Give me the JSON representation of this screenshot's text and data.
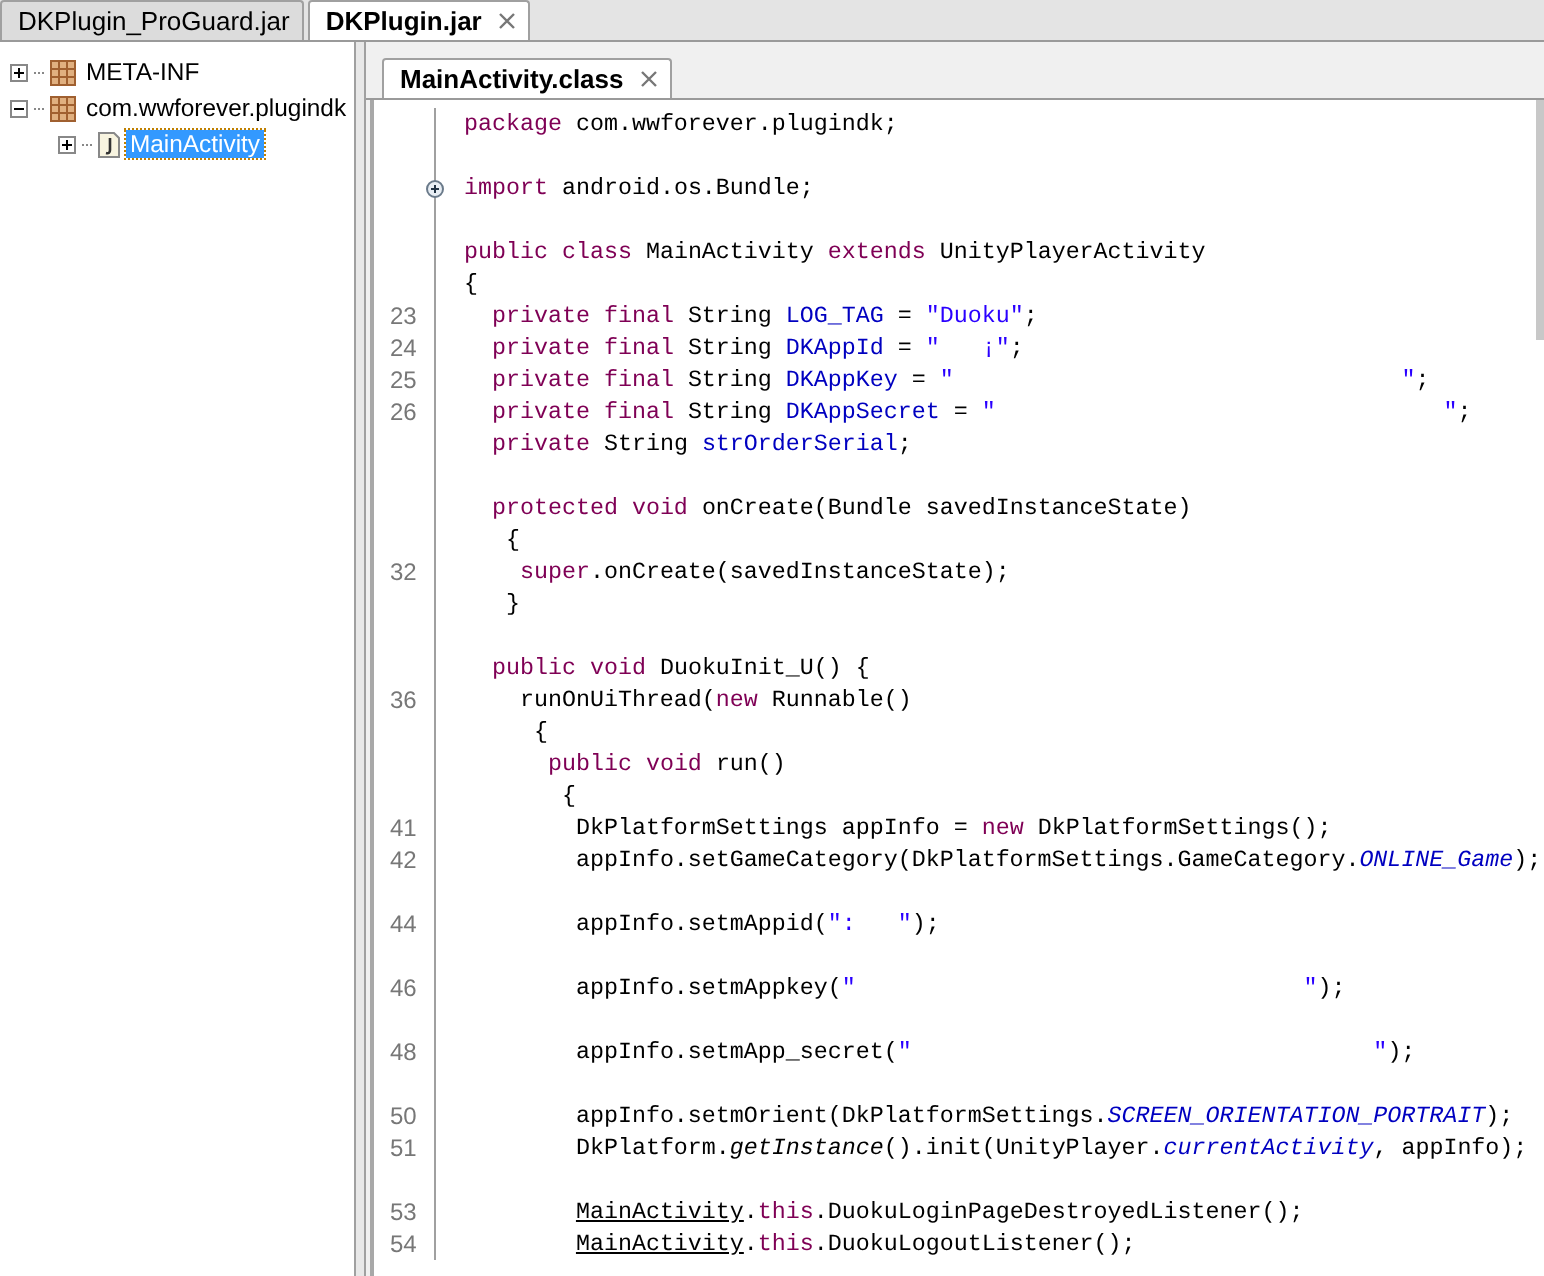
{
  "file_tabs": [
    {
      "label": "DKPlugin_ProGuard.jar",
      "selected": false
    },
    {
      "label": "DKPlugin.jar",
      "selected": true
    }
  ],
  "tree": [
    {
      "label": "META-INF",
      "kind": "package",
      "expanded": false,
      "selected": false
    },
    {
      "label": "com.wwforever.plugindk",
      "kind": "package",
      "expanded": true,
      "selected": false,
      "children": [
        {
          "label": "MainActivity",
          "kind": "class",
          "expanded": false,
          "selected": true
        }
      ]
    }
  ],
  "editor_tabs": [
    {
      "label": "MainActivity.class",
      "selected": true
    }
  ],
  "code_lines": [
    {
      "tokens": [
        {
          "kind": "keyword",
          "text": "package"
        },
        {
          "kind": "plain",
          "text": " com.wwforever.plugindk;"
        }
      ]
    },
    {
      "gap_before": true,
      "folded": true,
      "tokens": [
        {
          "kind": "keyword",
          "text": "import"
        },
        {
          "kind": "plain",
          "text": " android.os.Bundle;"
        }
      ]
    },
    {
      "gap_before": true,
      "tokens": [
        {
          "kind": "keyword",
          "text": "public class"
        },
        {
          "kind": "plain",
          "text": " MainActivity "
        },
        {
          "kind": "keyword",
          "text": "extends"
        },
        {
          "kind": "plain",
          "text": " UnityPlayerActivity"
        }
      ]
    },
    {
      "tokens": [
        {
          "kind": "plain",
          "text": "{"
        }
      ]
    },
    {
      "number": "23",
      "tokens": [
        {
          "kind": "keyword",
          "text": "  private final"
        },
        {
          "kind": "plain",
          "text": " String "
        },
        {
          "kind": "field",
          "text": "LOG_TAG"
        },
        {
          "kind": "plain",
          "text": " = "
        },
        {
          "kind": "string",
          "text": "\"Duoku\""
        },
        {
          "kind": "plain",
          "text": ";"
        }
      ]
    },
    {
      "number": "24",
      "tokens": [
        {
          "kind": "keyword",
          "text": "  private final"
        },
        {
          "kind": "plain",
          "text": " String "
        },
        {
          "kind": "field",
          "text": "DKAppId"
        },
        {
          "kind": "plain",
          "text": " = "
        },
        {
          "kind": "string",
          "text": "\"   ¡\""
        },
        {
          "kind": "plain",
          "text": ";"
        }
      ]
    },
    {
      "number": "25",
      "tokens": [
        {
          "kind": "keyword",
          "text": "  private final"
        },
        {
          "kind": "plain",
          "text": " String "
        },
        {
          "kind": "field",
          "text": "DKAppKey"
        },
        {
          "kind": "plain",
          "text": " = "
        },
        {
          "kind": "string",
          "text": "\"                                \""
        },
        {
          "kind": "plain",
          "text": ";"
        }
      ]
    },
    {
      "number": "26",
      "tokens": [
        {
          "kind": "keyword",
          "text": "  private final"
        },
        {
          "kind": "plain",
          "text": " String "
        },
        {
          "kind": "field",
          "text": "DKAppSecret"
        },
        {
          "kind": "plain",
          "text": " = "
        },
        {
          "kind": "string",
          "text": "\"                                \""
        },
        {
          "kind": "plain",
          "text": ";"
        }
      ]
    },
    {
      "tokens": [
        {
          "kind": "keyword",
          "text": "  private"
        },
        {
          "kind": "plain",
          "text": " String "
        },
        {
          "kind": "field",
          "text": "strOrderSerial"
        },
        {
          "kind": "plain",
          "text": ";"
        }
      ]
    },
    {
      "gap_before": true,
      "tokens": [
        {
          "kind": "keyword",
          "text": "  protected void"
        },
        {
          "kind": "plain",
          "text": " onCreate(Bundle savedInstanceState)"
        }
      ]
    },
    {
      "tokens": [
        {
          "kind": "plain",
          "text": "   {"
        }
      ]
    },
    {
      "number": "32",
      "tokens": [
        {
          "kind": "keyword",
          "text": "    super"
        },
        {
          "kind": "plain",
          "text": ".onCreate(savedInstanceState);"
        }
      ]
    },
    {
      "tokens": [
        {
          "kind": "plain",
          "text": "   }"
        }
      ]
    },
    {
      "gap_before": true,
      "tokens": [
        {
          "kind": "keyword",
          "text": "  public void"
        },
        {
          "kind": "plain",
          "text": " DuokuInit_U() {"
        }
      ]
    },
    {
      "number": "36",
      "tokens": [
        {
          "kind": "plain",
          "text": "    runOnUiThread("
        },
        {
          "kind": "keyword",
          "text": "new"
        },
        {
          "kind": "plain",
          "text": " Runnable()"
        }
      ]
    },
    {
      "tokens": [
        {
          "kind": "plain",
          "text": "     {"
        }
      ]
    },
    {
      "tokens": [
        {
          "kind": "keyword",
          "text": "      public void"
        },
        {
          "kind": "plain",
          "text": " run()"
        }
      ]
    },
    {
      "tokens": [
        {
          "kind": "plain",
          "text": "       {"
        }
      ]
    },
    {
      "number": "41",
      "tokens": [
        {
          "kind": "plain",
          "text": "        DkPlatformSettings appInfo = "
        },
        {
          "kind": "keyword",
          "text": "new"
        },
        {
          "kind": "plain",
          "text": " DkPlatformSettings();"
        }
      ]
    },
    {
      "number": "42",
      "tokens": [
        {
          "kind": "plain",
          "text": "        appInfo.setGameCategory(DkPlatformSettings.GameCategory."
        },
        {
          "kind": "static-field",
          "text": "ONLINE_Game"
        },
        {
          "kind": "plain",
          "text": ");"
        }
      ]
    },
    {
      "gap_before": true,
      "number": "44",
      "tokens": [
        {
          "kind": "plain",
          "text": "        appInfo.setmAppid("
        },
        {
          "kind": "string",
          "text": "\":   \""
        },
        {
          "kind": "plain",
          "text": ");"
        }
      ]
    },
    {
      "gap_before": true,
      "number": "46",
      "tokens": [
        {
          "kind": "plain",
          "text": "        appInfo.setmAppkey("
        },
        {
          "kind": "string",
          "text": "\"                                \""
        },
        {
          "kind": "plain",
          "text": ");"
        }
      ]
    },
    {
      "gap_before": true,
      "number": "48",
      "tokens": [
        {
          "kind": "plain",
          "text": "        appInfo.setmApp_secret("
        },
        {
          "kind": "string",
          "text": "\"                                 \""
        },
        {
          "kind": "plain",
          "text": ");"
        }
      ]
    },
    {
      "gap_before": true,
      "number": "50",
      "tokens": [
        {
          "kind": "plain",
          "text": "        appInfo.setmOrient(DkPlatformSettings."
        },
        {
          "kind": "static-field",
          "text": "SCREEN_ORIENTATION_PORTRAIT"
        },
        {
          "kind": "plain",
          "text": ");"
        }
      ]
    },
    {
      "number": "51",
      "tokens": [
        {
          "kind": "plain",
          "text": "        DkPlatform."
        },
        {
          "kind": "static-method",
          "text": "getInstance"
        },
        {
          "kind": "plain",
          "text": "().init(UnityPlayer."
        },
        {
          "kind": "static-field",
          "text": "currentActivity"
        },
        {
          "kind": "plain",
          "text": ", appInfo);"
        }
      ]
    },
    {
      "gap_before": true,
      "number": "53",
      "tokens": [
        {
          "kind": "link",
          "text": "        MainActivity"
        },
        {
          "kind": "plain",
          "text": "."
        },
        {
          "kind": "keyword",
          "text": "this"
        },
        {
          "kind": "plain",
          "text": ".DuokuLoginPageDestroyedListener();"
        }
      ]
    },
    {
      "number": "54",
      "tokens": [
        {
          "kind": "link",
          "text": "        MainActivity"
        },
        {
          "kind": "plain",
          "text": "."
        },
        {
          "kind": "keyword",
          "text": "this"
        },
        {
          "kind": "plain",
          "text": ".DuokuLogoutListener();"
        }
      ]
    }
  ]
}
